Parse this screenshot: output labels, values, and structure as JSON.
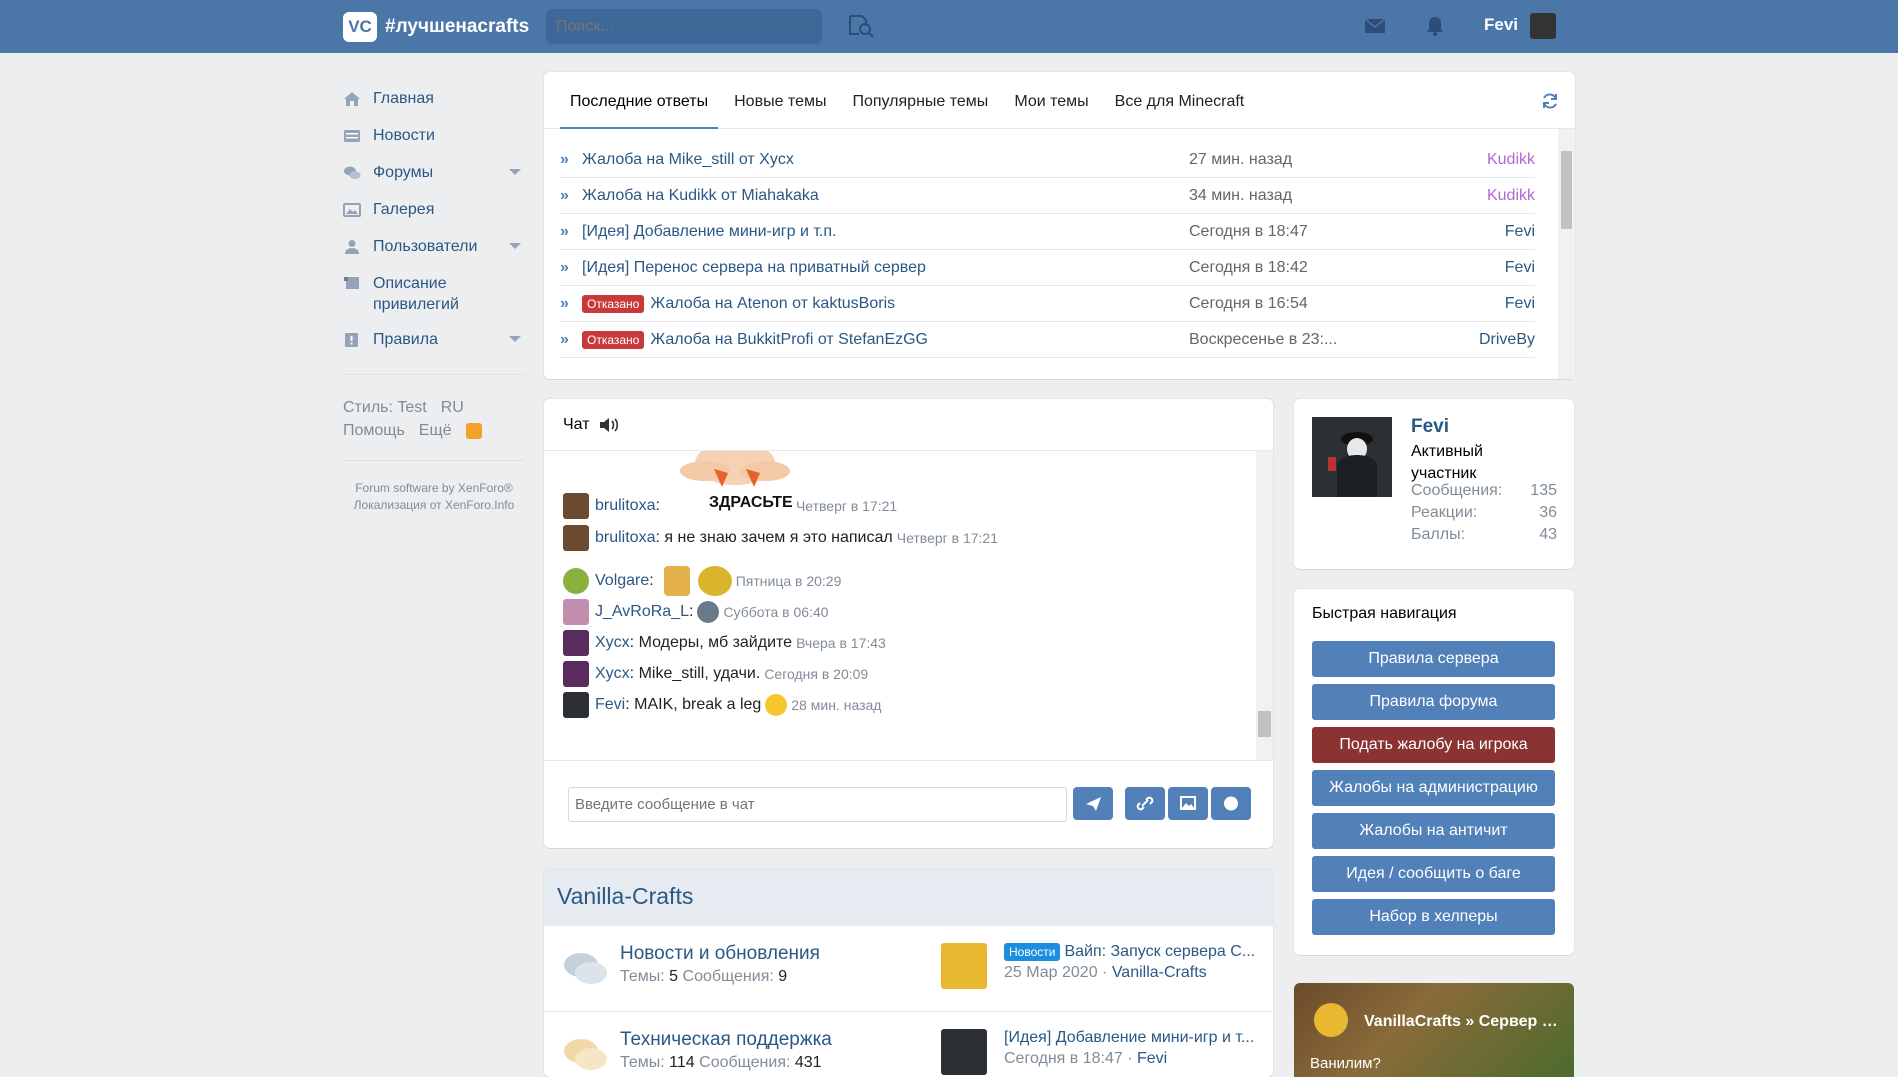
{
  "header": {
    "logo_badge": "VC",
    "logo_text": "#лучшенасrafts",
    "search_placeholder": "Поиск...",
    "username": "Fevi"
  },
  "nav": {
    "items": [
      {
        "label": "Главная",
        "icon": "home-icon"
      },
      {
        "label": "Новости",
        "icon": "news-icon"
      },
      {
        "label": "Форумы",
        "icon": "forums-icon"
      },
      {
        "label": "Галерея",
        "icon": "gallery-icon"
      },
      {
        "label": "Пользователи",
        "icon": "users-icon"
      },
      {
        "label": "Описание привилегий",
        "icon": "scroll-icon"
      },
      {
        "label": "Правила",
        "icon": "rules-icon"
      }
    ],
    "style_label": "Стиль: Test",
    "lang": "RU",
    "help": "Помощь",
    "more": "Ещё",
    "copyright1": "Forum software by XenForo®",
    "copyright2": "Локализация от XenForo.Info"
  },
  "tabs": [
    "Последние ответы",
    "Новые темы",
    "Популярные темы",
    "Мои темы",
    "Все для Minecraft"
  ],
  "threads": [
    {
      "tag": "",
      "title": "Жалоба на Mike_still от Xycx",
      "date": "27 мин. назад",
      "user": "Kudikk",
      "user_color": "#b366d6"
    },
    {
      "tag": "",
      "title": "Жалоба на Kudikk от Miahakaka",
      "date": "34 мин. назад",
      "user": "Kudikk",
      "user_color": "#b366d6"
    },
    {
      "tag": "",
      "title": "[Идея] Добавление мини-игр и т.п.",
      "date": "Сегодня в 18:47",
      "user": "Fevi",
      "user_color": "#2a5885"
    },
    {
      "tag": "",
      "title": "[Идея] Перенос сервера на приватный сервер",
      "date": "Сегодня в 18:42",
      "user": "Fevi",
      "user_color": "#2a5885"
    },
    {
      "tag": "Отказано",
      "title": "Жалоба на Atenon от kaktusBoris",
      "date": "Сегодня в 16:54",
      "user": "Fevi",
      "user_color": "#2a5885"
    },
    {
      "tag": "Отказано",
      "title": "Жалоба на BukkitProfi от StefanEzGG",
      "date": "Воскресенье в 23:...",
      "user": "DriveBy",
      "user_color": "#2a5885"
    }
  ],
  "chat": {
    "title": "Чат",
    "placeholder": "Введите сообщение в чат",
    "sticker_text": "ЗДРАСЬТЕ",
    "messages": [
      {
        "user": "brulitoxa",
        "text": ":",
        "date": "Четверг в 17:21"
      },
      {
        "user": "brulitoxa",
        "text": ": я не знаю зачем я это написал",
        "date": "Четверг в 17:21"
      },
      {
        "user": "Volgare",
        "text": ":",
        "date": "Пятница в 20:29"
      },
      {
        "user": "J_AvRoRa_L",
        "text": ":",
        "date": "Суббота в 06:40"
      },
      {
        "user": "Xycx",
        "text": ": Модеры, мб зайдите",
        "date": "Вчера в 17:43"
      },
      {
        "user": "Xycx",
        "text": ": Mike_still, удачи.",
        "date": "Сегодня в 20:09"
      },
      {
        "user": "Fevi",
        "text": ": MAIK, break a leg",
        "date": "28 мин. назад"
      }
    ]
  },
  "category": {
    "title": "Vanilla-Crafts",
    "forums": [
      {
        "title": "Новости и обновления",
        "threads_label": "Темы:",
        "threads": "5",
        "posts_label": "Сообщения:",
        "posts": "9",
        "tag": "Новости",
        "last": "Вайп: Запуск сервера С...",
        "date": "25 Мар 2020",
        "last_user": "Vanilla-Crafts"
      },
      {
        "title": "Техническая поддержка",
        "threads_label": "Темы:",
        "threads": "114",
        "posts_label": "Сообщения:",
        "posts": "431",
        "tag": "",
        "last": "[Идея] Добавление мини-игр и т...",
        "date": "Сегодня в 18:47",
        "last_user": "Fevi"
      }
    ]
  },
  "profile": {
    "name": "Fevi",
    "role": "Активный участник",
    "stats": [
      {
        "label": "Сообщения:",
        "value": "135"
      },
      {
        "label": "Реакции:",
        "value": "36"
      },
      {
        "label": "Баллы:",
        "value": "43"
      }
    ]
  },
  "quicknav": {
    "title": "Быстрая навигация",
    "buttons": [
      "Правила сервера",
      "Правила форума",
      "Подать жалобу на игрока",
      "Жалобы на администрацию",
      "Жалобы на античит",
      "Идея / сообщить о баге",
      "Набор в хелперы"
    ]
  },
  "promo": {
    "title": "VanillaCrafts » Сервер б...",
    "subtitle": "Ванилим?"
  },
  "colors": {
    "brand": "#4a76a8",
    "link": "#2a5885",
    "button": "#5181b8",
    "danger": "#8a3333"
  }
}
